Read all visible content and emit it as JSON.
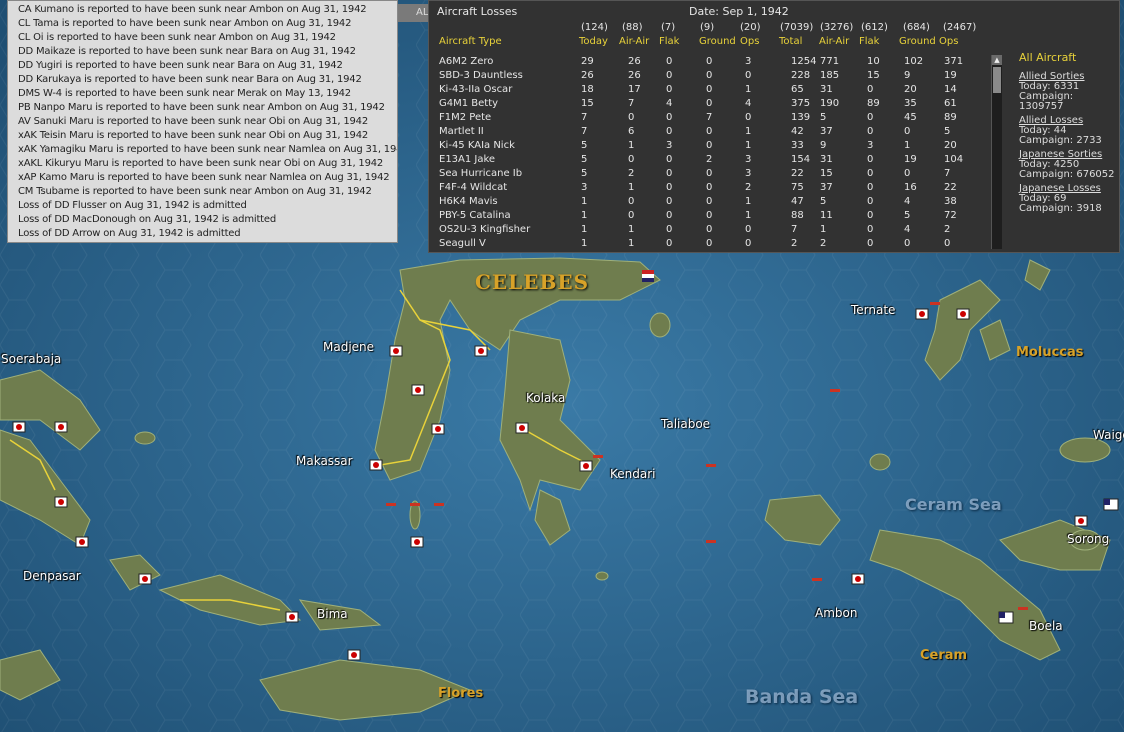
{
  "message_log": {
    "messages": [
      "CA Kumano is reported to have been sunk near Ambon on Aug 31, 1942",
      "CL Tama is reported to have been sunk near Ambon on Aug 31, 1942",
      "CL Oi is reported to have been sunk near Ambon on Aug 31, 1942",
      "DD Maikaze is reported to have been sunk near Bara on Aug 31, 1942",
      "DD Yugiri is reported to have been sunk near Bara on Aug 31, 1942",
      "DD Karukaya is reported to have been sunk near Bara on Aug 31, 1942",
      "DMS W-4 is reported to have been sunk near Merak on May 13, 1942",
      "PB Nanpo Maru is reported to have been sunk near Ambon on Aug 31, 1942",
      "AV Sanuki Maru is reported to have been sunk near Obi on Aug 31, 1942",
      "xAK Teisin Maru is reported to have been sunk near Obi on Aug 31, 1942",
      "xAK Yamagiku Maru is reported to have been sunk near Namlea on Aug 31, 1942",
      "xAKL Kikuryu Maru is reported to have been sunk near Obi on Aug 31, 1942",
      "xAP Kamo Maru is reported to have been sunk near Namlea on Aug 31, 1942",
      "CM Tsubame is reported to have been sunk near Ambon on Aug 31, 1942",
      "Loss of DD Flusser on Aug 31, 1942 is admitted",
      "Loss of DD MacDonough on Aug 31, 1942 is admitted",
      "Loss of DD Arrow on Aug 31, 1942 is admitted"
    ],
    "tab_label": "AL"
  },
  "aircraft_losses": {
    "title": "Aircraft Losses",
    "date": "Date: Sep 1, 1942",
    "header_totals": [
      "(124)",
      "(88)",
      "(7)",
      "(9)",
      "(20)",
      "(7039)",
      "(3276)",
      "(612)",
      "(684)",
      "(2467)"
    ],
    "columns": [
      "Aircraft Type",
      "Today",
      "Air-Air",
      "Flak",
      "Ground",
      "Ops",
      "Total",
      "Air-Air",
      "Flak",
      "Ground",
      "Ops"
    ],
    "rows": [
      [
        "A6M2 Zero",
        "29",
        "26",
        "0",
        "0",
        "3",
        "1254",
        "771",
        "10",
        "102",
        "371"
      ],
      [
        "SBD-3 Dauntless",
        "26",
        "26",
        "0",
        "0",
        "0",
        "228",
        "185",
        "15",
        "9",
        "19"
      ],
      [
        "Ki-43-IIa Oscar",
        "18",
        "17",
        "0",
        "0",
        "1",
        "65",
        "31",
        "0",
        "20",
        "14"
      ],
      [
        "G4M1 Betty",
        "15",
        "7",
        "4",
        "0",
        "4",
        "375",
        "190",
        "89",
        "35",
        "61"
      ],
      [
        "F1M2 Pete",
        "7",
        "0",
        "0",
        "7",
        "0",
        "139",
        "5",
        "0",
        "45",
        "89"
      ],
      [
        "Martlet II",
        "7",
        "6",
        "0",
        "0",
        "1",
        "42",
        "37",
        "0",
        "0",
        "5"
      ],
      [
        "Ki-45 KAIa Nick",
        "5",
        "1",
        "3",
        "0",
        "1",
        "33",
        "9",
        "3",
        "1",
        "20"
      ],
      [
        "E13A1 Jake",
        "5",
        "0",
        "0",
        "2",
        "3",
        "154",
        "31",
        "0",
        "19",
        "104"
      ],
      [
        "Sea Hurricane Ib",
        "5",
        "2",
        "0",
        "0",
        "3",
        "22",
        "15",
        "0",
        "0",
        "7"
      ],
      [
        "F4F-4 Wildcat",
        "3",
        "1",
        "0",
        "0",
        "2",
        "75",
        "37",
        "0",
        "16",
        "22"
      ],
      [
        "H6K4 Mavis",
        "1",
        "0",
        "0",
        "0",
        "1",
        "47",
        "5",
        "0",
        "4",
        "38"
      ],
      [
        "PBY-5 Catalina",
        "1",
        "0",
        "0",
        "0",
        "1",
        "88",
        "11",
        "0",
        "5",
        "72"
      ],
      [
        "OS2U-3 Kingfisher",
        "1",
        "1",
        "0",
        "0",
        "0",
        "7",
        "1",
        "0",
        "4",
        "2"
      ],
      [
        "Seagull V",
        "1",
        "1",
        "0",
        "0",
        "0",
        "2",
        "2",
        "0",
        "0",
        "0"
      ]
    ],
    "side": {
      "all_aircraft": "All Aircraft",
      "blocks": [
        {
          "title": "Allied Sorties",
          "today": "Today:   6331",
          "campaign": "Campaign: 1309757"
        },
        {
          "title": "Allied Losses",
          "today": "Today:   44",
          "campaign": "Campaign: 2733"
        },
        {
          "title": "Japanese Sorties",
          "today": "Today:   4250",
          "campaign": "Campaign: 676052"
        },
        {
          "title": "Japanese Losses",
          "today": "Today:   69",
          "campaign": "Campaign: 3918"
        }
      ]
    }
  },
  "map": {
    "labels": {
      "celebes": "CELEBES",
      "moluccas": "Moluccas",
      "ceram": "Ceram",
      "flores": "Flores",
      "ceram_sea": "Ceram Sea",
      "banda_sea": "Banda Sea",
      "soerabaja": "Soerabaja",
      "madjene": "Madjene",
      "makassar": "Makassar",
      "kolaka": "Kolaka",
      "taliaboe": "Taliaboe",
      "kendari": "Kendari",
      "ternate": "Ternate",
      "waigeo": "Waige",
      "sorong": "Sorong",
      "ambon": "Ambon",
      "boela": "Boela",
      "denpasar": "Denpasar",
      "bima": "Bima"
    },
    "colors": {
      "sea": "#2a5f86",
      "land": "#6f7d4e",
      "road": "#e8d23a",
      "region_label": "#d8a228"
    }
  }
}
